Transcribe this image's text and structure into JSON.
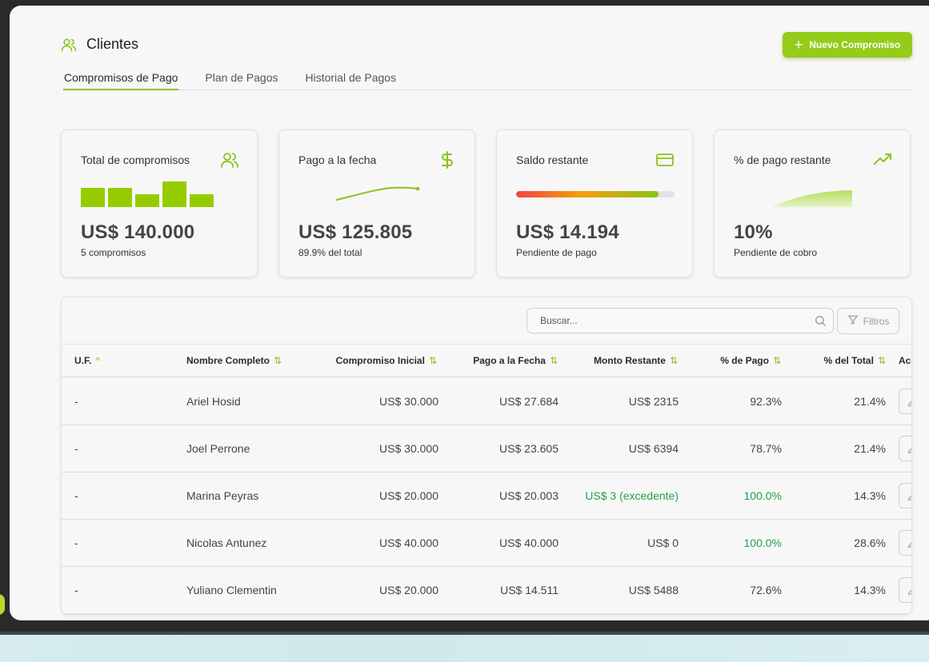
{
  "header": {
    "title": "Clientes",
    "new_button_label": "Nuevo Compromiso"
  },
  "tabs": [
    {
      "label": "Compromisos de Pago",
      "active": true
    },
    {
      "label": "Plan de Pagos",
      "active": false
    },
    {
      "label": "Historial de Pagos",
      "active": false
    }
  ],
  "cards": {
    "total": {
      "title": "Total de compromisos",
      "value": "US$ 140.000",
      "subtitle": "5 compromisos",
      "icon": "users-icon",
      "bar_values": [
        30000,
        30000,
        20000,
        40000,
        20000
      ]
    },
    "paid": {
      "title": "Pago a la fecha",
      "value": "US$ 125.805",
      "subtitle": "89.9% del total",
      "icon": "dollar-icon"
    },
    "remaining": {
      "title": "Saldo restante",
      "value": "US$ 14.194",
      "subtitle": "Pendiente de pago",
      "icon": "credit-card-icon",
      "progress_fraction": 0.899
    },
    "percent": {
      "title": "% de pago restante",
      "value": "10%",
      "subtitle": "Pendiente de cobro",
      "icon": "trending-up-icon"
    }
  },
  "table": {
    "search_placeholder": "Buscar...",
    "filter_label": "Filtros",
    "columns": {
      "uf": "U.F.",
      "name": "Nombre Completo",
      "initial": "Compromiso Inicial",
      "paid": "Pago a la Fecha",
      "remaining": "Monto Restante",
      "pct_paid": "% de Pago",
      "pct_total": "% del Total",
      "actions": "Acc"
    },
    "rows": [
      {
        "uf": "-",
        "name": "Ariel Hosid",
        "initial": "US$ 30.000",
        "paid": "US$ 27.684",
        "remaining": "US$ 2315",
        "pct_paid": "92.3%",
        "pct_total": "21.4%"
      },
      {
        "uf": "-",
        "name": "Joel Perrone",
        "initial": "US$ 30.000",
        "paid": "US$ 23.605",
        "remaining": "US$ 6394",
        "pct_paid": "78.7%",
        "pct_total": "21.4%"
      },
      {
        "uf": "-",
        "name": "Marina Peyras",
        "initial": "US$ 20.000",
        "paid": "US$ 20.003",
        "remaining": "US$ 3 (excedente)",
        "pct_paid": "100.0%",
        "pct_total": "14.3%"
      },
      {
        "uf": "-",
        "name": "Nicolas Antunez",
        "initial": "US$ 40.000",
        "paid": "US$ 40.000",
        "remaining": "US$ 0",
        "pct_paid": "100.0%",
        "pct_total": "28.6%"
      },
      {
        "uf": "-",
        "name": "Yuliano Clementin",
        "initial": "US$ 20.000",
        "paid": "US$ 14.511",
        "remaining": "US$ 5488",
        "pct_paid": "72.6%",
        "pct_total": "14.3%"
      }
    ]
  },
  "colors": {
    "accent": "#94cc1a",
    "positive": "#22a04b",
    "bar": "#95cc00"
  }
}
